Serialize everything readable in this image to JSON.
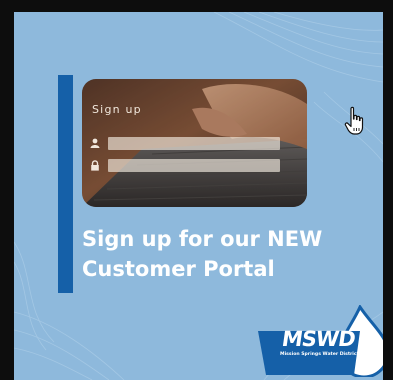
{
  "promo": {
    "signup_label": "Sign up",
    "headline_line1": "Sign up for our NEW",
    "headline_line2": "Customer Portal"
  },
  "login_fields": [
    {
      "icon": "user-icon"
    },
    {
      "icon": "lock-icon"
    }
  ],
  "logo": {
    "text": "MSWD",
    "subtitle": "Mission Springs Water District"
  },
  "colors": {
    "background": "#8eb9dc",
    "accent_bar": "#1560a8",
    "logo_blue": "#1560a8",
    "headline": "#ffffff"
  },
  "cursor": {
    "icon": "hand-pointer-icon"
  }
}
